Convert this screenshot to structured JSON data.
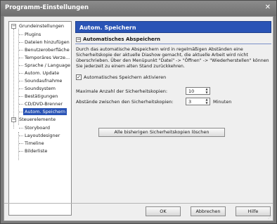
{
  "window": {
    "title": "Programm-Einstellungen",
    "close_glyph": "✕"
  },
  "tree": {
    "groups": [
      {
        "label": "Grundeinstellungen",
        "expander": "−",
        "items": [
          "Plugins",
          "Dateien hinzufügen",
          "Benutzeroberfläche",
          "Temporäres Verze...",
          "Sprache / Language",
          "Autom. Update",
          "Soundaufnahme",
          "Soundsystem",
          "Bestätigungen",
          "CD/DVD-Brenner",
          "Autom. Speichern"
        ]
      },
      {
        "label": "Steuerelemente",
        "expander": "−",
        "items": [
          "Storyboard",
          "Layoutdesigner",
          "Timeline",
          "Bilderliste"
        ]
      }
    ],
    "selected": "Autom. Speichern"
  },
  "panel": {
    "header": "Autom. Speichern",
    "section": {
      "toggle": "−",
      "title": "Automatisches Abspeichern"
    },
    "description": "Durch das automatische Abspeichern wird in regelmäßigen Abständen eine Sicherheitskopie der aktuelle Diashow gemacht, die aktuelle Arbeit wird nicht überschrieben. Über den Menüpunkt \"Datei\" -> \"Öffnen\" -> \"Wiederherstellen\" können Sie jederzeit zu einem alten Stand zurückkehren.",
    "checkbox": {
      "label": "Automatisches Speichern aktivieren",
      "checked": true,
      "mark": "✓"
    },
    "max_copies": {
      "label": "Maximale Anzahl der Sicherheitskopien:",
      "value": "10"
    },
    "interval": {
      "label": "Abstände zwischen den Sicherheitskopien:",
      "value": "3",
      "unit": "Minuten"
    },
    "delete_button": "Alle bisherigen Sicherheitskopien löschen",
    "spin_up": "▲",
    "spin_down": "▼"
  },
  "footer": {
    "ok": "OK",
    "cancel": "Abbrechen",
    "help": "Hilfe",
    "grip": "⋰"
  }
}
